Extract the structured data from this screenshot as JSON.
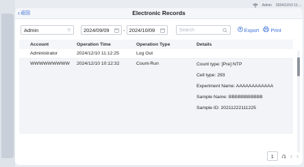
{
  "status_bar": {
    "user": "Admin",
    "datetime": "2024/12/10 11:..."
  },
  "header": {
    "back_label": "返回",
    "title": "Electronic Records"
  },
  "toolbar": {
    "account_select": "Admin",
    "start_date": "2024/09/09",
    "date_separator": "-",
    "end_date": "2024/10/09",
    "search_placeholder": "Search",
    "export_label": "Export",
    "print_label": "Print"
  },
  "table": {
    "columns": [
      "Account",
      "Operation Time",
      "Operation Type",
      "Details"
    ],
    "rows": [
      {
        "account": "Administrator",
        "time": "2024/12/10 11:12:25",
        "type": "Log Out",
        "details": [
          ""
        ]
      },
      {
        "account": "WWWWWWWWW",
        "time": "2024/12/10 10:12:32",
        "type": "Count-Run",
        "details": [
          "Count type: [Pre] NTP",
          "Cell type: 293",
          "Experiment Name: AAAAAAAAAAAA",
          "Sample Name: BBBBBBBBBBB",
          "Sample ID: 20211222111225"
        ]
      }
    ]
  },
  "pagination": {
    "current_page": "1",
    "total_pages": "/1"
  },
  "icons": {
    "back": "chevron-left-icon",
    "dropdown": "chevron-down-icon",
    "calendar": "calendar-icon",
    "search": "search-icon",
    "export": "export-icon",
    "print": "printer-icon",
    "wifi": "wifi-icon"
  },
  "colors": {
    "accent": "#3b6fd8",
    "background": "#e9ecf1",
    "header_bg": "#f4f6f9",
    "row_highlight": "#f2f4f7"
  }
}
